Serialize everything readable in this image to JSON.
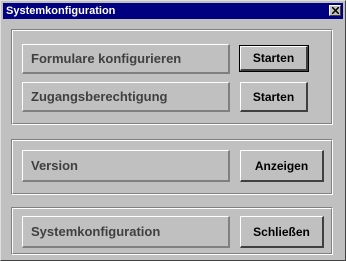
{
  "window": {
    "title": "Systemkonfiguration"
  },
  "group1": {
    "rows": [
      {
        "label": "Formulare konfigurieren",
        "button": "Starten"
      },
      {
        "label": "Zugangsberechtigung",
        "button": "Starten"
      }
    ]
  },
  "group2": {
    "label": "Version",
    "button": "Anzeigen"
  },
  "group3": {
    "label": "Systemkonfiguration",
    "button": "Schließen"
  },
  "icons": {
    "close": "close-icon"
  }
}
